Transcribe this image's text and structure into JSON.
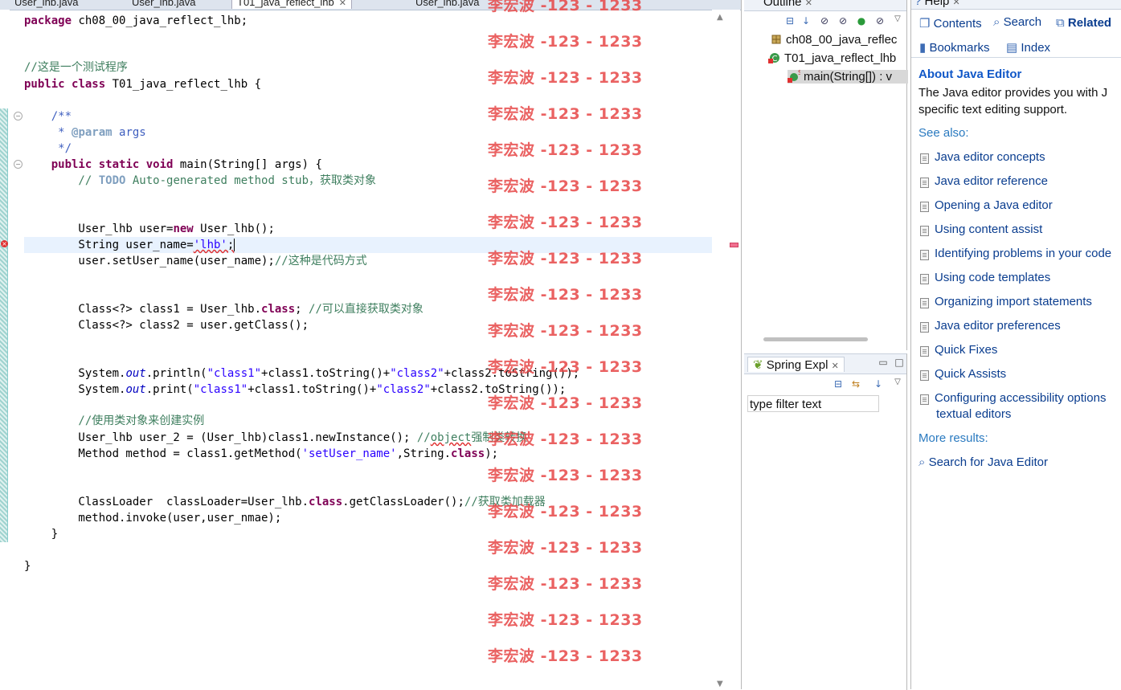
{
  "editor": {
    "tabs": [
      {
        "label": "User_lhb.java",
        "close": ""
      },
      {
        "label": "User_lhb.java",
        "close": ""
      },
      {
        "label": "T01_java_reflect_lhb",
        "close": "✕"
      },
      {
        "label": "User_lhb.java",
        "close": ""
      }
    ],
    "code": {
      "l1": [
        "package",
        " ch08_00_java_reflect_lhb;"
      ],
      "l2": "//这是一个测试程序",
      "l3": [
        "public",
        " ",
        "class",
        " T01_java_reflect_lhb {"
      ],
      "l4": "    /**",
      "l5": [
        "     * ",
        "@param",
        " args"
      ],
      "l6": "     */",
      "l7": [
        "    ",
        "public",
        " ",
        "static",
        " ",
        "void",
        " main(String[] args) {"
      ],
      "l8": [
        "        // ",
        "TODO",
        " Auto-generated method stub，获取类对象"
      ],
      "l9": [
        "        User_lhb user=",
        "new",
        " User_lhb();"
      ],
      "l10": [
        "        String user_name=",
        "'lhb'",
        ";"
      ],
      "l11": [
        "        user.setUser_name(user_name);",
        "//这种是代码方式"
      ],
      "l12": [
        "        Class<?> class1 = User_lhb.",
        "class",
        "; ",
        "//可以直接获取类对象"
      ],
      "l13": "        Class<?> class2 = user.getClass();",
      "l14": [
        "        System.",
        "out",
        ".println(",
        "\"class1\"",
        "+class1.toString()+",
        "\"class2\"",
        "+class2.toString());"
      ],
      "l15": [
        "        System.",
        "out",
        ".print(",
        "\"class1\"",
        "+class1.toString()+",
        "\"class2\"",
        "+class2.toString());"
      ],
      "l16": "        //使用类对象来创建实例",
      "l17": [
        "        User_lhb user_2 = (User_lhb)class1.newInstance(); ",
        "//",
        "object",
        "强制类转换"
      ],
      "l18": [
        "        Method method = class1.getMethod(",
        "'setUser_name'",
        ",String.",
        "class",
        ");"
      ],
      "l19": [
        "        ClassLoader  classLoader=User_lhb.",
        "class",
        ".getClassLoader();",
        "//获取类加载器"
      ],
      "l20": "        method.invoke(user,user_nmae);",
      "l21": "    }",
      "l22": "}"
    },
    "watermark": "李宏波 -123 - 1233"
  },
  "outline": {
    "title": "Outline",
    "close": "✕",
    "items": [
      {
        "label": "ch08_00_java_reflec"
      },
      {
        "label": "T01_java_reflect_lhb"
      },
      {
        "label": "main(String[]) : v"
      }
    ]
  },
  "spring": {
    "title": "Spring Expl",
    "close": "✕",
    "filter_value": "type filter text"
  },
  "help": {
    "title": "Help",
    "close": "✕",
    "nav": {
      "contents": "Contents",
      "search": "Search",
      "related": "Related",
      "bookmarks": "Bookmarks",
      "index": "Index"
    },
    "heading": "About Java Editor",
    "desc1": "The Java editor provides you with J",
    "desc2": "specific text editing support.",
    "see_also": "See also:",
    "links": [
      "Java editor concepts",
      "Java editor reference",
      "Opening a Java editor",
      "Using content assist",
      "Identifying problems in your code",
      "Using code templates",
      "Organizing import statements",
      "Java editor preferences",
      "Quick Fixes",
      "Quick Assists",
      "Configuring accessibility options"
    ],
    "link_cont": "textual editors",
    "more_results": "More results:",
    "search_for": "Search for Java Editor"
  }
}
